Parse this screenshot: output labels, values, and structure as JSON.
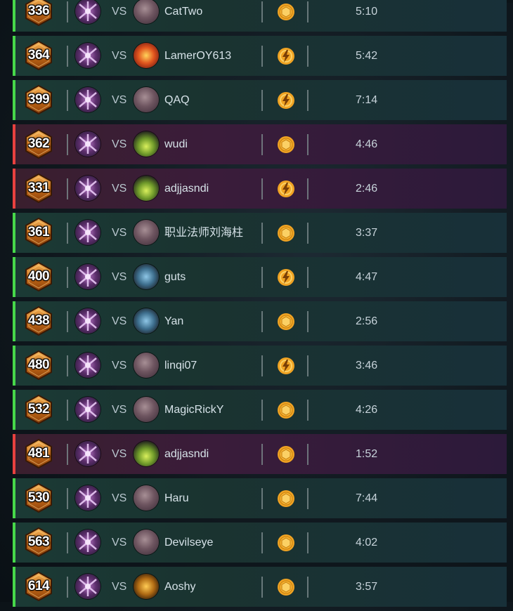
{
  "colors": {
    "win_accent": "#47d84a",
    "loss_accent": "#e8413f",
    "icon_gold": "#f0a323"
  },
  "vs_label": "VS",
  "matches": [
    {
      "rank": "336",
      "result": "win",
      "opponent": "CatTwo",
      "opponent_avatar": "mage-avatar-icon",
      "mode": "coin",
      "duration": "5:10"
    },
    {
      "rank": "364",
      "result": "win",
      "opponent": "LamerOY613",
      "opponent_avatar": "fire-avatar-icon",
      "mode": "bolt",
      "duration": "5:42"
    },
    {
      "rank": "399",
      "result": "win",
      "opponent": "QAQ",
      "opponent_avatar": "mage-avatar-icon",
      "mode": "bolt",
      "duration": "7:14"
    },
    {
      "rank": "362",
      "result": "loss",
      "opponent": "wudi",
      "opponent_avatar": "green-avatar-icon",
      "mode": "coin",
      "duration": "4:46"
    },
    {
      "rank": "331",
      "result": "loss",
      "opponent": "adjjasndi",
      "opponent_avatar": "green-avatar-icon",
      "mode": "bolt",
      "duration": "2:46"
    },
    {
      "rank": "361",
      "result": "win",
      "opponent": "职业法师刘海柱",
      "opponent_avatar": "mage-avatar-icon",
      "mode": "coin",
      "duration": "3:37"
    },
    {
      "rank": "400",
      "result": "win",
      "opponent": "guts",
      "opponent_avatar": "mech-avatar-icon",
      "mode": "bolt",
      "duration": "4:47"
    },
    {
      "rank": "438",
      "result": "win",
      "opponent": "Yan",
      "opponent_avatar": "mech-avatar-icon",
      "mode": "coin",
      "duration": "2:56"
    },
    {
      "rank": "480",
      "result": "win",
      "opponent": "linqi07",
      "opponent_avatar": "mage-avatar-icon",
      "mode": "bolt",
      "duration": "3:46"
    },
    {
      "rank": "532",
      "result": "win",
      "opponent": "MagicRickY",
      "opponent_avatar": "mage-avatar-icon",
      "mode": "coin",
      "duration": "4:26"
    },
    {
      "rank": "481",
      "result": "loss",
      "opponent": "adjjasndi",
      "opponent_avatar": "green-avatar-icon",
      "mode": "coin",
      "duration": "1:52"
    },
    {
      "rank": "530",
      "result": "win",
      "opponent": "Haru",
      "opponent_avatar": "mage-avatar-icon",
      "mode": "coin",
      "duration": "7:44"
    },
    {
      "rank": "563",
      "result": "win",
      "opponent": "Devilseye",
      "opponent_avatar": "mage-avatar-icon",
      "mode": "coin",
      "duration": "4:02"
    },
    {
      "rank": "614",
      "result": "win",
      "opponent": "Aoshy",
      "opponent_avatar": "gold-avatar-icon",
      "mode": "coin",
      "duration": "3:57"
    }
  ]
}
